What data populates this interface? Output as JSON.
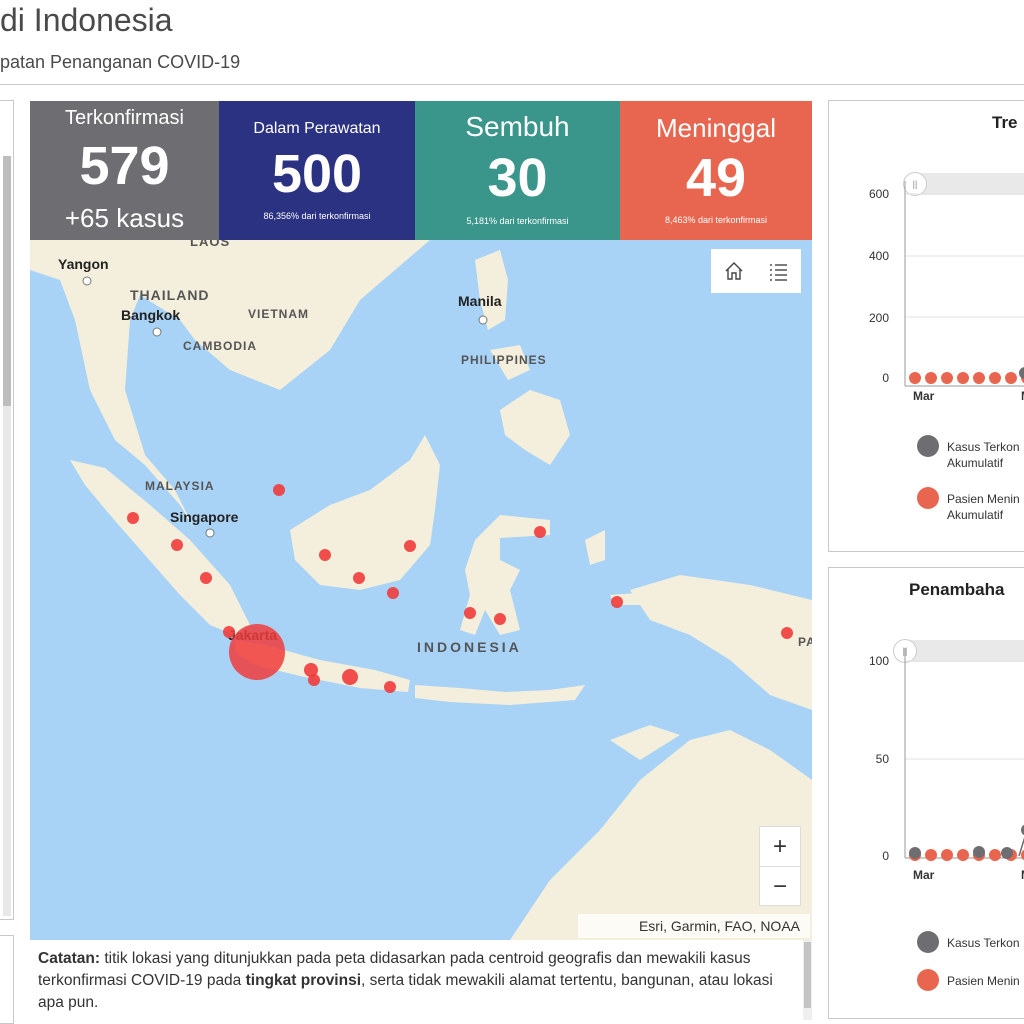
{
  "header": {
    "title": "di Indonesia",
    "subtitle": "patan Penanganan COVID-19"
  },
  "stats": [
    {
      "label": "Terkonfirmasi",
      "value": "579",
      "extra": "+65 kasus",
      "color": "#6e6e72"
    },
    {
      "label": "Dalam Perawatan",
      "value": "500",
      "note": "86,356% dari terkonfirmasi",
      "color": "#2b3281"
    },
    {
      "label": "Sembuh",
      "value": "30",
      "note": "5,181% dari terkonfirmasi",
      "color": "#3a958a"
    },
    {
      "label": "Meninggal",
      "value": "49",
      "note": "8,463% dari terkonfirmasi",
      "color": "#e8664f"
    }
  ],
  "map": {
    "labels": {
      "yangon": "Yangon",
      "thailand": "THAILAND",
      "bangkok": "Bangkok",
      "vietnam": "VIETNAM",
      "cambodia": "CAMBODIA",
      "laos": "LAOS",
      "manila": "Manila",
      "philippines": "PHILIPPINES",
      "malaysia": "MALAYSIA",
      "singapore": "Singapore",
      "jakarta": "Jakarta",
      "indonesia": "INDONESIA",
      "pa": "PA"
    },
    "toolbar": {
      "home_icon": "home-icon",
      "legend_icon": "list-icon"
    },
    "zoom": {
      "in": "+",
      "out": "−"
    },
    "attribution": "Esri, Garmin, FAO, NOAA",
    "colors": {
      "water": "#a8d3f6",
      "land": "#f4efdc",
      "case": "#f03b3b"
    }
  },
  "note": {
    "label": "Catatan:",
    "text1": " titik lokasi yang ditunjukkan pada peta didasarkan pada centroid geografis dan mewakili kasus terkonfirmasi COVID-19 pada ",
    "bold": "tingkat provinsi",
    "text2": ", serta tidak mewakili alamat tertentu, bangunan, atau lokasi apa pun."
  },
  "chart1": {
    "title": "Tre",
    "yticks": [
      "600",
      "400",
      "200",
      "0"
    ],
    "xtick": "Mar",
    "xtick2": "M",
    "legend": [
      {
        "l1": "Kasus Terkon",
        "l2": "Akumulatif",
        "color": "#6e6e72"
      },
      {
        "l1": "Pasien Menin",
        "l2": "Akumulatif",
        "color": "#e8664f"
      }
    ]
  },
  "chart2": {
    "title": "Penambaha",
    "yticks": [
      "100",
      "50",
      "0"
    ],
    "xtick": "Mar",
    "xtick2": "M",
    "legend": [
      {
        "l1": "Kasus Terkon",
        "color": "#6e6e72"
      },
      {
        "l1": "Pasien Menin",
        "color": "#e8664f"
      }
    ]
  }
}
